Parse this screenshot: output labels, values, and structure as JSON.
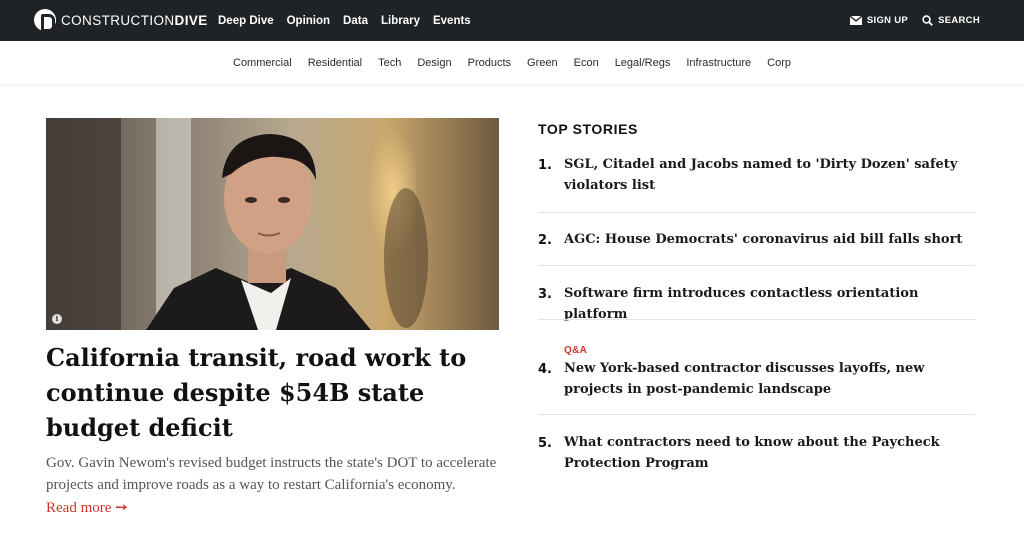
{
  "brand": {
    "name_light": "CONSTRUCTION",
    "name_bold": "DIVE"
  },
  "main_nav": [
    "Deep Dive",
    "Opinion",
    "Data",
    "Library",
    "Events"
  ],
  "utility": {
    "signup": "SIGN UP",
    "search": "SEARCH"
  },
  "categories": [
    "Commercial",
    "Residential",
    "Tech",
    "Design",
    "Products",
    "Green",
    "Econ",
    "Legal/Regs",
    "Infrastructure",
    "Corp"
  ],
  "hero": {
    "title": "California transit, road work to continue despite $54B state budget deficit",
    "description": "Gov. Gavin Newom's revised budget instructs the state's DOT to accelerate projects and improve roads as a way to restart California's economy.",
    "read_more": "Read more ➙",
    "info_glyph": "i"
  },
  "top_stories": {
    "heading": "TOP STORIES",
    "items": [
      {
        "num": "1.",
        "title": "SGL, Citadel and Jacobs named to 'Dirty Dozen' safety violators list"
      },
      {
        "num": "2.",
        "title": "AGC: House Democrats' coronavirus aid bill falls short"
      },
      {
        "num": "3.",
        "title": "Software firm introduces contactless orientation platform"
      },
      {
        "num": "4.",
        "kicker": "Q&A",
        "title": "New York-based contractor discusses layoffs, new projects in post-pandemic landscape"
      },
      {
        "num": "5.",
        "title": "What contractors need to know about the Paycheck Protection Program"
      }
    ]
  },
  "colors": {
    "topbar": "#1f2326",
    "accent": "#d0342c"
  },
  "icons": {
    "signup": "envelope-icon",
    "search": "search-icon",
    "logo": "logo-icon"
  }
}
